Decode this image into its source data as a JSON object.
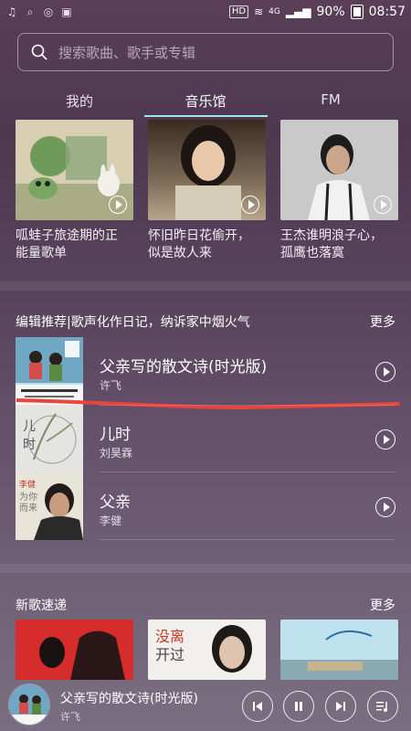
{
  "status": {
    "time": "08:57",
    "battery": "90%",
    "network": "4G",
    "hd": "HD",
    "icons": [
      "music-note-icon",
      "search-icon",
      "weibo-icon",
      "gallery-icon"
    ]
  },
  "search": {
    "placeholder": "搜索歌曲、歌手或专辑"
  },
  "tabs": [
    {
      "label": "我的"
    },
    {
      "label": "音乐馆",
      "active": true
    },
    {
      "label": "FM"
    }
  ],
  "top_playlists": [
    {
      "title_l1": "呱蛙子旅途期的正",
      "title_l2": "能量歌单"
    },
    {
      "title_l1": "怀旧昨日花偷开，",
      "title_l2": "似是故人来"
    },
    {
      "title_l1": "王杰谁明浪子心，",
      "title_l2": "孤鹰也落寞"
    }
  ],
  "editor_section": {
    "heading": "编辑推荐|歌声化作日记，纳诉家中烟火气",
    "more": "更多",
    "songs": [
      {
        "title": "父亲写的散文诗(时光版)",
        "artist": "许飞"
      },
      {
        "title": "儿时",
        "artist": "刘昊霖"
      },
      {
        "title": "父亲",
        "artist": "李健"
      }
    ]
  },
  "new_section": {
    "heading": "新歌速递",
    "more": "更多"
  },
  "player": {
    "title": "父亲写的散文诗(时光版)",
    "artist": "许飞"
  },
  "colors": {
    "accent_underline": "#9ee7f0",
    "annotation_red": "#e8453c"
  }
}
